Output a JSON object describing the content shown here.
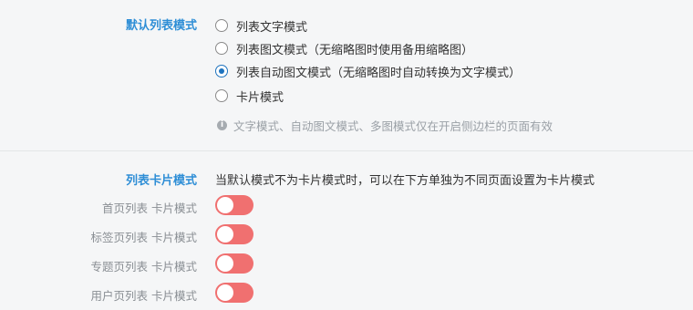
{
  "default_list_mode": {
    "title": "默认列表模式",
    "options": [
      {
        "label": "列表文字模式",
        "checked": false
      },
      {
        "label": "列表图文模式（无缩略图时使用备用缩略图）",
        "checked": false
      },
      {
        "label": "列表自动图文模式（无缩略图时自动转换为文字模式）",
        "checked": true
      },
      {
        "label": "卡片模式",
        "checked": false
      }
    ],
    "hint": "文字模式、自动图文模式、多图模式仅在开启侧边栏的页面有效",
    "hint_icon": "info-icon"
  },
  "card_mode": {
    "title": "列表卡片模式",
    "description": "当默认模式不为卡片模式时，可以在下方单独为不同页面设置为卡片模式",
    "toggles": [
      {
        "label": "首页列表 卡片模式",
        "on": false
      },
      {
        "label": "标签页列表 卡片模式",
        "on": false
      },
      {
        "label": "专题页列表 卡片模式",
        "on": false
      },
      {
        "label": "用户页列表 卡片模式",
        "on": false
      }
    ],
    "toggle_color": "#f07070"
  },
  "colors": {
    "accent": "#2e8ed6",
    "radio_checked": "#1e73be"
  }
}
